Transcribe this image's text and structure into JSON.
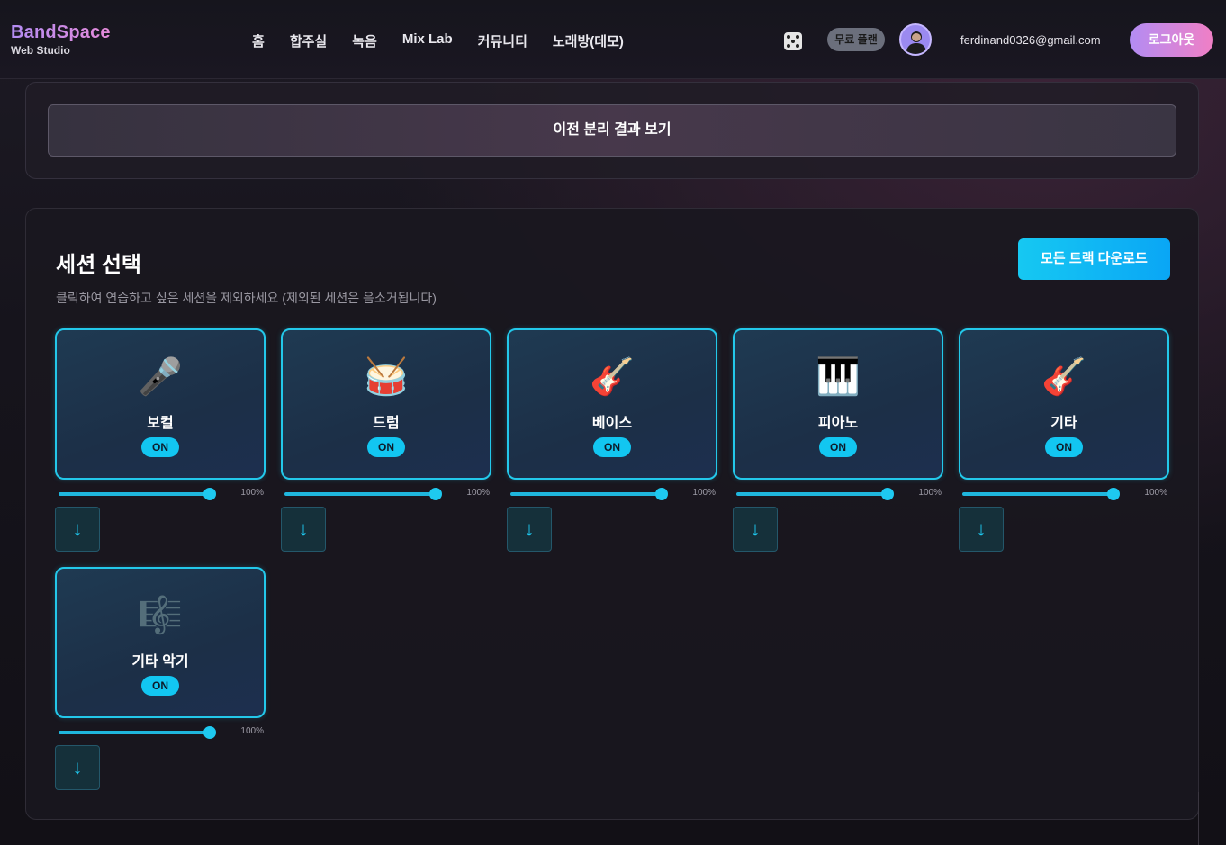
{
  "header": {
    "brand_name": "BandSpace",
    "brand_sub": "Web Studio",
    "nav": [
      "홈",
      "합주실",
      "녹음",
      "Mix Lab",
      "커뮤니티",
      "노래방(데모)"
    ],
    "plan_badge": "무료 플랜",
    "email": "ferdinand0326@gmail.com",
    "logout_label": "로그아웃",
    "icons": [
      "dice-icon",
      "avatar-icon"
    ]
  },
  "top_card": {
    "prev_button_label": "이전 분리 결과 보기"
  },
  "session": {
    "title": "세션 선택",
    "description": "클릭하여 연습하고 싶은 세션을 제외하세요 (제외된 세션은 음소거됩니다)",
    "download_all_label": "모든 트랙 다운로드",
    "tracks": [
      {
        "name": "보컬",
        "icon": "🎤",
        "icon_name": "microphone-icon",
        "status": "ON",
        "volume": "100%",
        "volume_level": 1.0,
        "download_label": "↓"
      },
      {
        "name": "드럼",
        "icon": "🥁",
        "icon_name": "drum-icon",
        "status": "ON",
        "volume": "100%",
        "volume_level": 1.0,
        "download_label": "↓"
      },
      {
        "name": "베이스",
        "icon": "🎸",
        "icon_name": "guitar-icon",
        "status": "ON",
        "volume": "100%",
        "volume_level": 1.0,
        "download_label": "↓"
      },
      {
        "name": "피아노",
        "icon": "🎹",
        "icon_name": "piano-icon",
        "status": "ON",
        "volume": "100%",
        "volume_level": 1.0,
        "download_label": "↓"
      },
      {
        "name": "기타",
        "icon": "🎸",
        "icon_name": "guitar-icon",
        "status": "ON",
        "volume": "100%",
        "volume_level": 1.0,
        "download_label": "↓"
      },
      {
        "name": "기타 악기",
        "icon": "🎼",
        "icon_name": "music-score-icon",
        "status": "ON",
        "volume": "100%",
        "volume_level": 1.0,
        "download_label": "↓"
      }
    ]
  },
  "colors": {
    "accent": "#23c8ea",
    "brand_gradient_start": "#b38cf3",
    "brand_gradient_end": "#f07fc5"
  }
}
